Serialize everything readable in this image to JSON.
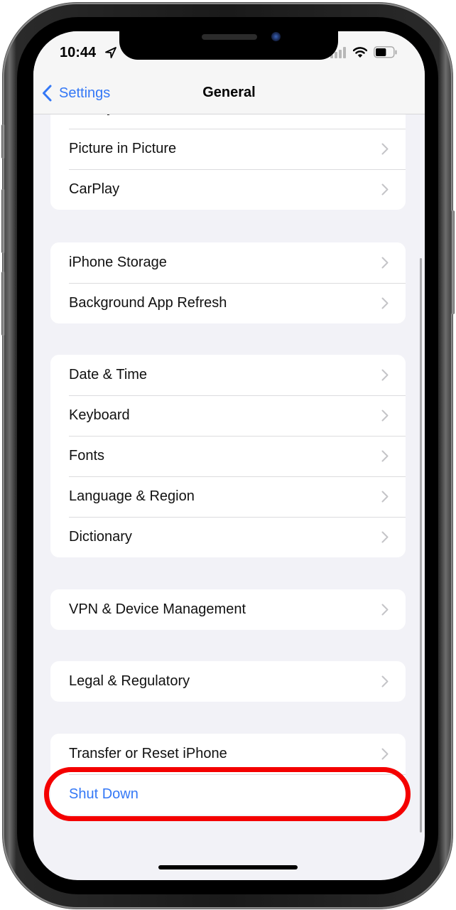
{
  "status_bar": {
    "time": "10:44",
    "battery_level": 0.6,
    "icons": [
      "location-arrow-icon",
      "cellular-signal-icon",
      "wifi-icon",
      "battery-icon"
    ]
  },
  "nav": {
    "back_label": "Settings",
    "back_icon": "chevron-left-icon",
    "title": "General"
  },
  "groups": [
    {
      "rows": [
        {
          "label": "AirPlay & Handoff",
          "chevron": true,
          "partially_hidden": true
        },
        {
          "label": "Picture in Picture",
          "chevron": true
        },
        {
          "label": "CarPlay",
          "chevron": true
        }
      ]
    },
    {
      "rows": [
        {
          "label": "iPhone Storage",
          "chevron": true
        },
        {
          "label": "Background App Refresh",
          "chevron": true
        }
      ]
    },
    {
      "rows": [
        {
          "label": "Date & Time",
          "chevron": true
        },
        {
          "label": "Keyboard",
          "chevron": true
        },
        {
          "label": "Fonts",
          "chevron": true
        },
        {
          "label": "Language & Region",
          "chevron": true
        },
        {
          "label": "Dictionary",
          "chevron": true
        }
      ]
    },
    {
      "rows": [
        {
          "label": "VPN & Device Management",
          "chevron": true
        }
      ]
    },
    {
      "rows": [
        {
          "label": "Legal & Regulatory",
          "chevron": true
        }
      ]
    },
    {
      "rows": [
        {
          "label": "Transfer or Reset iPhone",
          "chevron": true
        },
        {
          "label": "Shut Down",
          "chevron": false,
          "style": "action"
        }
      ]
    }
  ],
  "annotation": {
    "type": "highlight-oval",
    "target": "Shut Down",
    "color": "#f40000"
  },
  "colors": {
    "accent": "#3478f6",
    "background": "#f2f2f7",
    "cell": "#ffffff",
    "chevron": "#c4c4c7",
    "separator": "#dcdcde"
  }
}
